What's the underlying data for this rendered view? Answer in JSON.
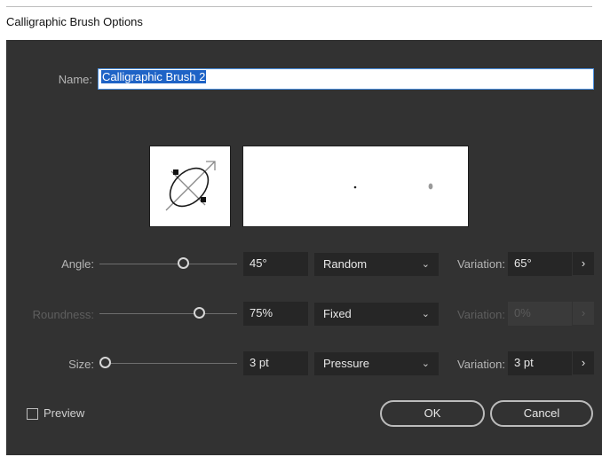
{
  "window": {
    "title": "Calligraphic Brush Options"
  },
  "name": {
    "label": "Name:",
    "value": "Calligraphic Brush 2"
  },
  "rows": {
    "angle": {
      "label": "Angle:",
      "value": "45°",
      "mode": "Random",
      "variation_label": "Variation:",
      "variation_value": "65°",
      "slider_fraction": 0.53
    },
    "roundness": {
      "label": "Roundness:",
      "value": "75%",
      "mode": "Fixed",
      "variation_label": "Variation:",
      "variation_value": "0%",
      "slider_fraction": 0.72
    },
    "size": {
      "label": "Size:",
      "value": "3 pt",
      "mode": "Pressure",
      "variation_label": "Variation:",
      "variation_value": "3 pt",
      "slider_fraction": 0.0
    }
  },
  "icons": {
    "chevron": "chevron-down-icon",
    "arrow": "chevron-right-icon"
  },
  "preview": {
    "label": "Preview",
    "checked": false
  },
  "buttons": {
    "ok": "OK",
    "cancel": "Cancel"
  },
  "colors": {
    "panel": "#323232",
    "field": "#262626",
    "selection": "#1e63c6"
  }
}
